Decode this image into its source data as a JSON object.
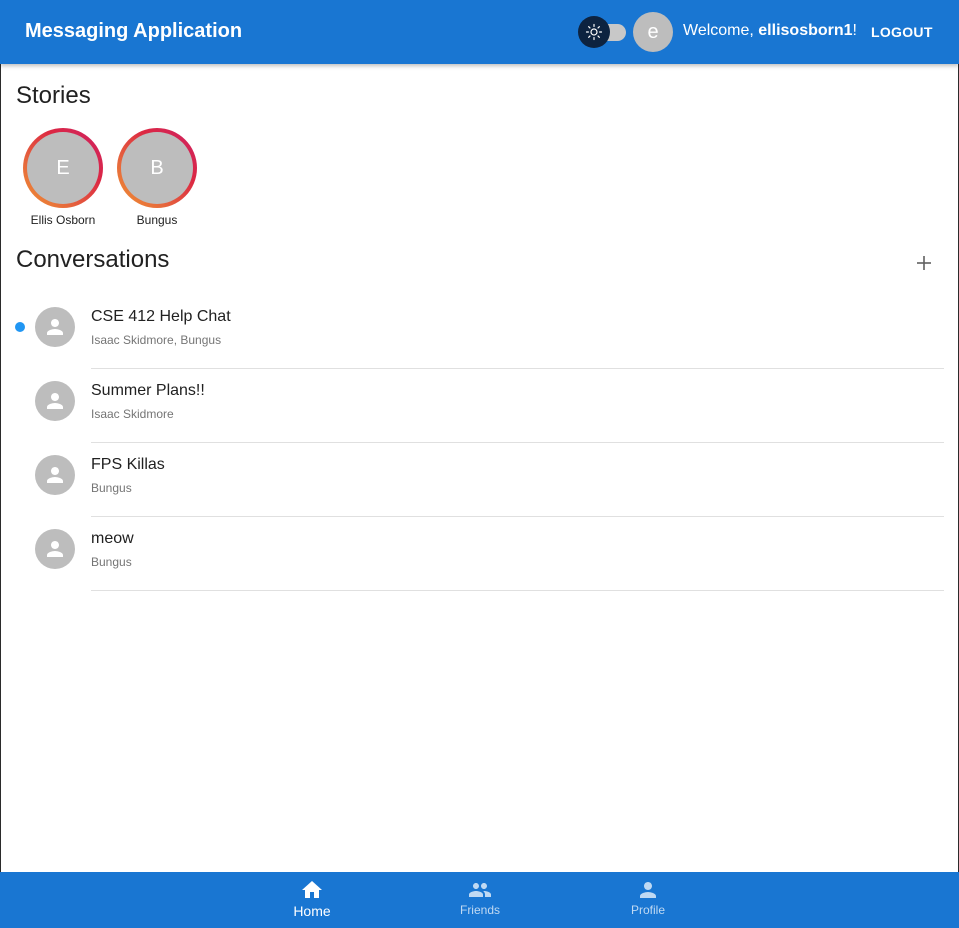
{
  "appbar": {
    "title": "Messaging Application",
    "avatar_letter": "e",
    "welcome_prefix": "Welcome, ",
    "username": "ellisosborn1",
    "welcome_suffix": "!",
    "logout_label": "LOGOUT",
    "color": "#1976d2"
  },
  "theme_toggle": {
    "icon": "sun-icon",
    "checked": false
  },
  "stories": {
    "title": "Stories",
    "items": [
      {
        "letter": "E",
        "name": "Ellis Osborn"
      },
      {
        "letter": "B",
        "name": "Bungus"
      }
    ]
  },
  "conversations": {
    "title": "Conversations",
    "add_icon": "plus-icon",
    "items": [
      {
        "name": "CSE 412 Help Chat",
        "members": "Isaac Skidmore, Bungus",
        "unread": true
      },
      {
        "name": "Summer Plans!!",
        "members": "Isaac Skidmore",
        "unread": false
      },
      {
        "name": "FPS Killas",
        "members": "Bungus",
        "unread": false
      },
      {
        "name": "meow",
        "members": "Bungus",
        "unread": false
      }
    ]
  },
  "bottom_nav": {
    "items": [
      {
        "label": "Home",
        "icon": "home-icon",
        "active": true
      },
      {
        "label": "Friends",
        "icon": "people-icon",
        "active": false
      },
      {
        "label": "Profile",
        "icon": "person-icon",
        "active": false
      }
    ]
  }
}
